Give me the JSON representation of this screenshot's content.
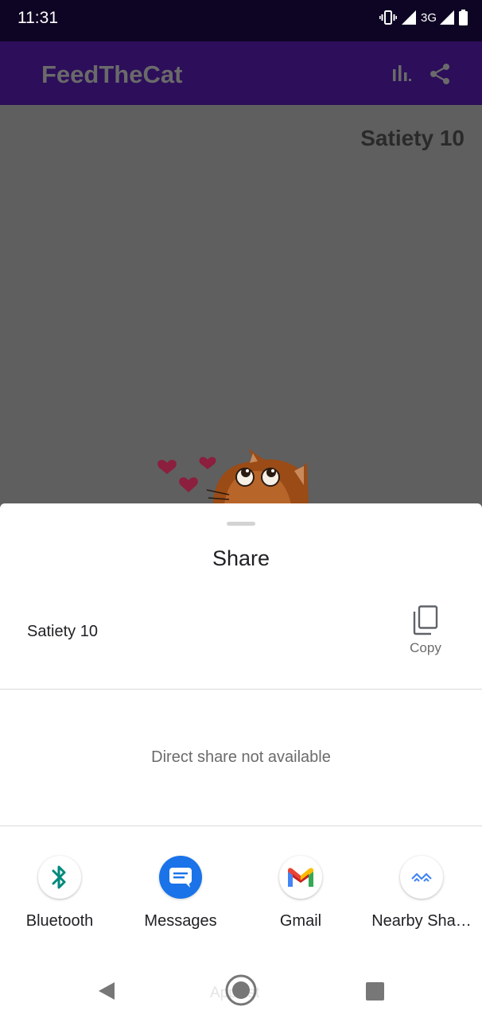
{
  "status_bar": {
    "time": "11:31",
    "network": "3G",
    "icons": [
      "vibrate-icon",
      "signal-icon",
      "signal-icon",
      "battery-icon"
    ]
  },
  "app_bar": {
    "title": "FeedTheCat",
    "actions": [
      "bar-chart-icon",
      "share-icon"
    ]
  },
  "main": {
    "satiety_label": "Satiety 10"
  },
  "share_sheet": {
    "title": "Share",
    "shared_text": "Satiety 10",
    "copy_label": "Copy",
    "direct_share_message": "Direct share not available",
    "apps": [
      {
        "label": "Bluetooth",
        "icon": "bluetooth-icon"
      },
      {
        "label": "Messages",
        "icon": "messages-icon"
      },
      {
        "label": "Gmail",
        "icon": "gmail-icon"
      },
      {
        "label": "Nearby Sha…",
        "icon": "nearby-share-icon"
      }
    ]
  },
  "nav_bar": {
    "buttons": [
      "back-icon",
      "home-icon",
      "recents-icon"
    ],
    "ghost_label": "App list"
  },
  "colors": {
    "status_bar": "#0e0524",
    "app_bar": "#2c0e5a",
    "scrim": "#5f5f5f",
    "messages_blue": "#1a73e8",
    "bluetooth_teal": "#00897b"
  }
}
